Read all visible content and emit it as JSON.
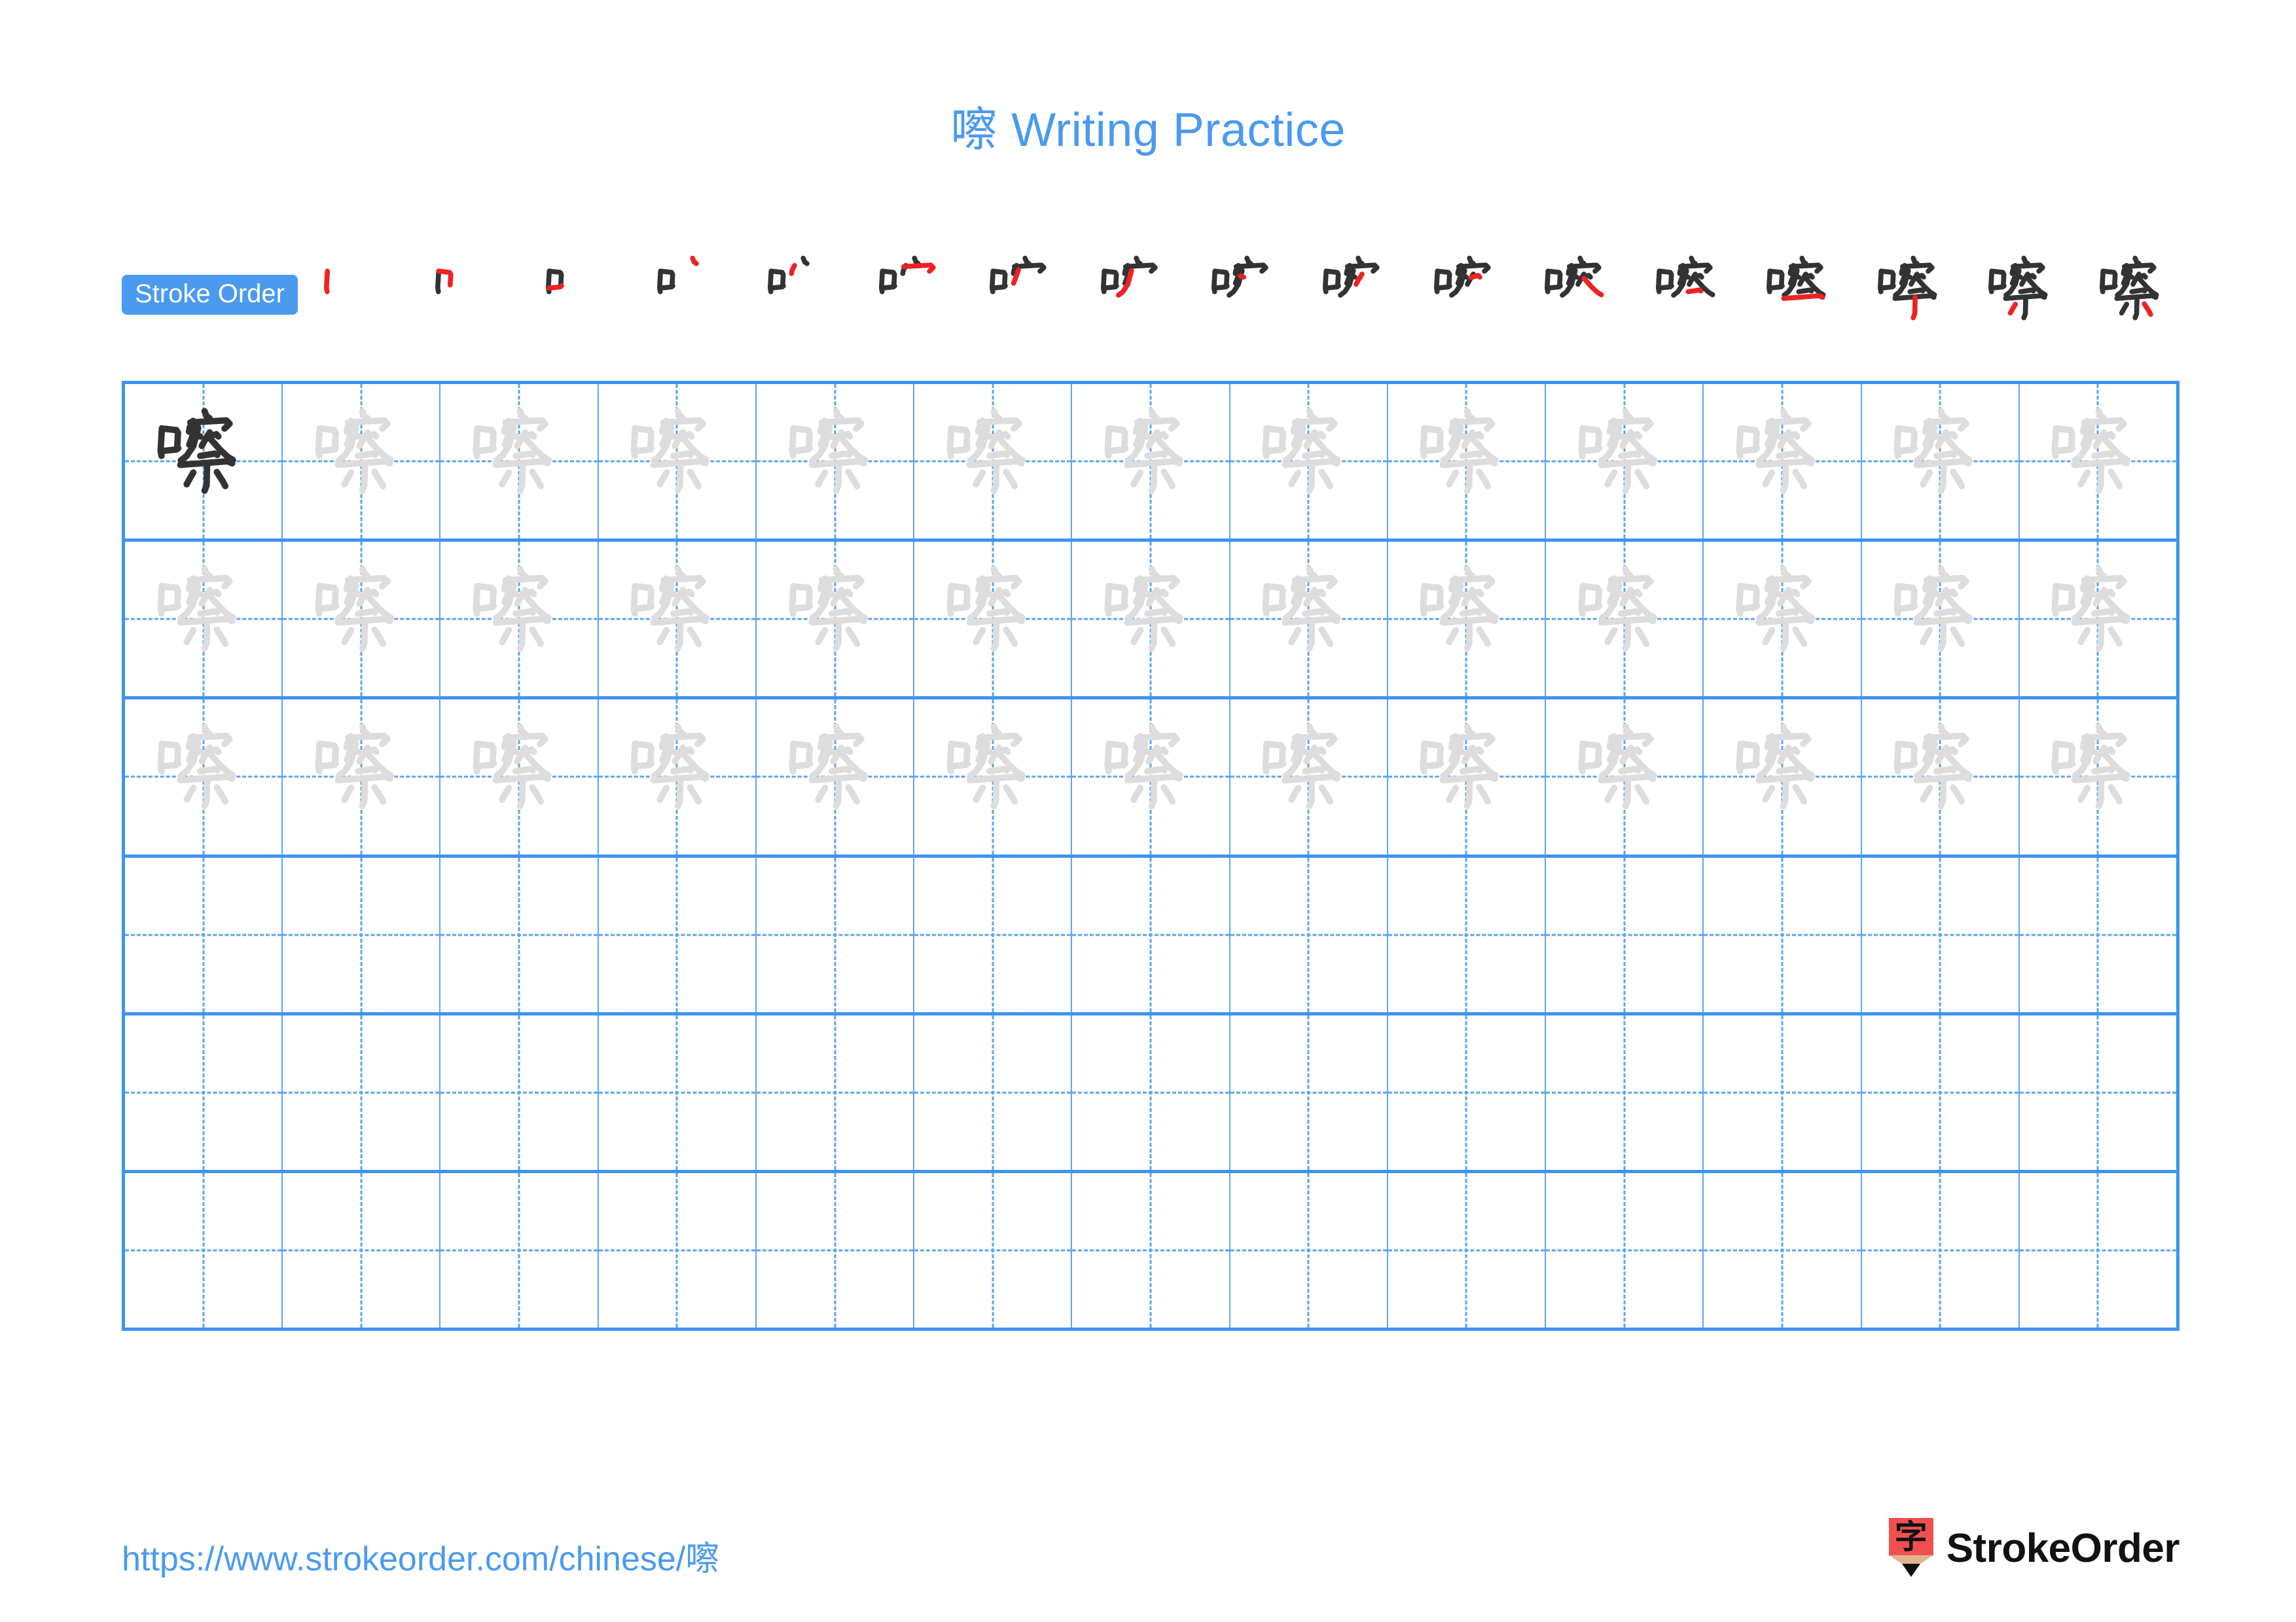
{
  "page": {
    "character": "嚓",
    "title": "嚓 Writing Practice",
    "accent_blue": "#4a9aef",
    "grid_line_blue": "#3d94f0",
    "dash_blue": "#5aa5f2",
    "stroke_new_color": "#ee2222",
    "stroke_done_color": "#333333",
    "trace_gray": "#dddddd",
    "model_dark": "#333333"
  },
  "stroke_order": {
    "badge_label": "Stroke Order",
    "total_strokes": 17,
    "steps": [
      {
        "index": 1,
        "drawn": 1
      },
      {
        "index": 2,
        "drawn": 2
      },
      {
        "index": 3,
        "drawn": 3
      },
      {
        "index": 4,
        "drawn": 4
      },
      {
        "index": 5,
        "drawn": 5
      },
      {
        "index": 6,
        "drawn": 6
      },
      {
        "index": 7,
        "drawn": 7
      },
      {
        "index": 8,
        "drawn": 8
      },
      {
        "index": 9,
        "drawn": 9
      },
      {
        "index": 10,
        "drawn": 10
      },
      {
        "index": 11,
        "drawn": 11
      },
      {
        "index": 12,
        "drawn": 12
      },
      {
        "index": 13,
        "drawn": 13
      },
      {
        "index": 14,
        "drawn": 14
      },
      {
        "index": 15,
        "drawn": 15
      },
      {
        "index": 16,
        "drawn": 16
      },
      {
        "index": 17,
        "drawn": 17
      }
    ]
  },
  "practice_grid": {
    "columns": 13,
    "rows": 6,
    "cells": [
      [
        "model",
        "trace",
        "trace",
        "trace",
        "trace",
        "trace",
        "trace",
        "trace",
        "trace",
        "trace",
        "trace",
        "trace",
        "trace"
      ],
      [
        "trace",
        "trace",
        "trace",
        "trace",
        "trace",
        "trace",
        "trace",
        "trace",
        "trace",
        "trace",
        "trace",
        "trace",
        "trace"
      ],
      [
        "trace",
        "trace",
        "trace",
        "trace",
        "trace",
        "trace",
        "trace",
        "trace",
        "trace",
        "trace",
        "trace",
        "trace",
        "trace"
      ],
      [
        "empty",
        "empty",
        "empty",
        "empty",
        "empty",
        "empty",
        "empty",
        "empty",
        "empty",
        "empty",
        "empty",
        "empty",
        "empty"
      ],
      [
        "empty",
        "empty",
        "empty",
        "empty",
        "empty",
        "empty",
        "empty",
        "empty",
        "empty",
        "empty",
        "empty",
        "empty",
        "empty"
      ],
      [
        "empty",
        "empty",
        "empty",
        "empty",
        "empty",
        "empty",
        "empty",
        "empty",
        "empty",
        "empty",
        "empty",
        "empty",
        "empty"
      ]
    ]
  },
  "footer": {
    "url": "https://www.strokeorder.com/chinese/嚓",
    "logo_char": "字",
    "logo_text": "StrokeOrder"
  }
}
